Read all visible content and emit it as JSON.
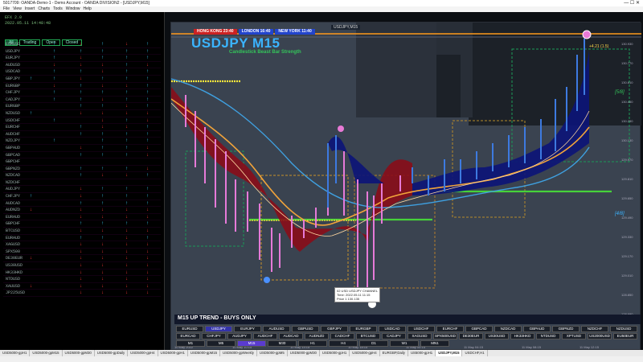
{
  "window": {
    "title": "5017709: OANDA-Demo-1 - Demo Account - OANDA DIVISION2 - [USDJPY,M15]",
    "controls": "— ☐ ✕"
  },
  "menu": [
    "File",
    "View",
    "Insert",
    "Charts",
    "Tools",
    "Window",
    "Help"
  ],
  "left_panel": {
    "header_lines": [
      "EFX 2.0",
      "2022.05.11 14:48:48"
    ],
    "tabs": [
      "All",
      "Trading",
      "Open",
      "Closed"
    ],
    "active_tab": "All",
    "pairs": [
      {
        "name": "EURUSD",
        "cols": [
          "",
          "up",
          "dn",
          "up",
          "dn",
          "up"
        ]
      },
      {
        "name": "USDJPY",
        "cols": [
          "",
          "up",
          "up",
          "up",
          "up",
          "up"
        ]
      },
      {
        "name": "EURJPY",
        "cols": [
          "",
          "up",
          "dn",
          "up",
          "up",
          "up"
        ]
      },
      {
        "name": "AUDUSD",
        "cols": [
          "",
          "dn",
          "dn",
          "dn",
          "up",
          "dn"
        ]
      },
      {
        "name": "USDCAD",
        "cols": [
          "",
          "up",
          "up",
          "dn",
          "up",
          "up"
        ]
      },
      {
        "name": "GBPJPY",
        "cols": [
          "up",
          "up",
          "dn",
          "up",
          "up",
          "up"
        ]
      },
      {
        "name": "EURGBP",
        "cols": [
          "",
          "dn",
          "up",
          "dn",
          "dn",
          "up"
        ]
      },
      {
        "name": "CHFJPY",
        "cols": [
          "",
          "up",
          "up",
          "up",
          "up",
          "up"
        ]
      },
      {
        "name": "CADJPY",
        "cols": [
          "",
          "up",
          "up",
          "dn",
          "up",
          "up"
        ]
      },
      {
        "name": "EURGBP",
        "cols": [
          "",
          "",
          "up",
          "up",
          "dn",
          "up"
        ]
      },
      {
        "name": "NZDUSD",
        "cols": [
          "up",
          "",
          "dn",
          "dn",
          "dn",
          "dn"
        ]
      },
      {
        "name": "USDCHF",
        "cols": [
          "",
          "up",
          "",
          "dn",
          "up",
          "dn"
        ]
      },
      {
        "name": "EURCHF",
        "cols": [
          "",
          "",
          "up",
          "dn",
          "dn",
          "up"
        ]
      },
      {
        "name": "AUDCHF",
        "cols": [
          "",
          "",
          "up",
          "up",
          "up",
          "up"
        ]
      },
      {
        "name": "NZDJPY",
        "cols": [
          "",
          "up",
          "",
          "up",
          "up",
          "up"
        ]
      },
      {
        "name": "GBPAUD",
        "cols": [
          "",
          "",
          "dn",
          "up",
          "up",
          "dn"
        ]
      },
      {
        "name": "GBPCAD",
        "cols": [
          "",
          "",
          "up",
          "up",
          "up",
          "dn"
        ]
      },
      {
        "name": "GBPCHF",
        "cols": [
          "",
          "",
          "",
          "",
          "",
          ""
        ]
      },
      {
        "name": "GBPNZD",
        "cols": [
          "",
          "",
          "up",
          "up",
          "up",
          "dn"
        ]
      },
      {
        "name": "NZDCAD",
        "cols": [
          "",
          "",
          "up",
          "dn",
          "dn",
          "up"
        ]
      },
      {
        "name": "NZDCHF",
        "cols": [
          "",
          "",
          "",
          "",
          "",
          ""
        ]
      },
      {
        "name": "AUDJPY",
        "cols": [
          "",
          "",
          "dn",
          "up",
          "up",
          "up"
        ]
      },
      {
        "name": "CHFJPY",
        "cols": [
          "up",
          "",
          "dn",
          "up",
          "up",
          "up"
        ]
      },
      {
        "name": "AUDCAD",
        "cols": [
          "",
          "",
          "up",
          "up",
          "up",
          "up"
        ]
      },
      {
        "name": "AUDNZD",
        "cols": [
          "dn",
          "",
          "dn",
          "dn",
          "dn",
          "dn"
        ]
      },
      {
        "name": "EURAUD",
        "cols": [
          "",
          "",
          "dn",
          "dn",
          "dn",
          "dn"
        ]
      },
      {
        "name": "GBPCHF",
        "cols": [
          "",
          "",
          "up",
          "up",
          "up",
          "up"
        ]
      },
      {
        "name": "BTCUSD",
        "cols": [
          "",
          "",
          "dn",
          "dn",
          "dn",
          "dn"
        ]
      },
      {
        "name": "EURAUD",
        "cols": [
          "",
          "",
          "up",
          "up",
          "dn",
          "up"
        ]
      },
      {
        "name": "XAGUSD",
        "cols": [
          "",
          "",
          "dn",
          "dn",
          "dn",
          "dn"
        ]
      },
      {
        "name": "SPX500",
        "cols": [
          "",
          "",
          "dn",
          "dn",
          "dn",
          "dn"
        ]
      },
      {
        "name": "DE30EUR",
        "cols": [
          "dn",
          "",
          "dn",
          "dn",
          "dn",
          "dn"
        ]
      },
      {
        "name": "US30USD",
        "cols": [
          "",
          "",
          "dn",
          "dn",
          "dn",
          "dn"
        ]
      },
      {
        "name": "HK33HKD",
        "cols": [
          "",
          "",
          "dn",
          "dn",
          "dn",
          "dn"
        ]
      },
      {
        "name": "NTDUSD",
        "cols": [
          "",
          "",
          "dn",
          "dn",
          "dn",
          "dn"
        ]
      },
      {
        "name": "XAUUSD",
        "cols": [
          "dn",
          "",
          "dn",
          "dn",
          "dn",
          "dn"
        ]
      },
      {
        "name": "JP225USD",
        "cols": [
          "",
          "",
          "dn",
          "dn",
          "dn",
          "dn"
        ]
      }
    ]
  },
  "chart": {
    "window_caption": "USDJPY,M15",
    "symbol_title": "USDJPY M15",
    "subtitle": "Candlestick Beast Bar Strength",
    "sessions": [
      {
        "label": "HONG KONG 23:40",
        "color": "#cc2222"
      },
      {
        "label": "LONDON 16:40",
        "color": "#2244cc"
      },
      {
        "label": "NEW YORK 11:40",
        "color": "#2244cc"
      }
    ],
    "fib_labels": [
      {
        "text": "[5/8]",
        "color": "#34c45a"
      },
      {
        "text": "[4/8]",
        "color": "#3bb4ff"
      }
    ],
    "price_flag": "+4.21 (1.5)",
    "info_box": [
      "02 USD USDJPY CHANNEL",
      "Time: 2022.05.11 11:15",
      "Price 1  130.135"
    ],
    "trend_banner": "M15 UP TREND - BUYS ONLY",
    "price_axis": [
      "130.930",
      "130.770",
      "130.610",
      "130.450",
      "130.290",
      "130.130",
      "129.970",
      "129.810",
      "129.650",
      "129.490",
      "129.330",
      "129.170",
      "129.010",
      "128.850",
      "128.690"
    ],
    "time_axis": [
      "10 May 2022",
      "10 May 10:15",
      "10 May 14:15",
      "10 May 18:15",
      "11 May 00:15",
      "11 May 04:15",
      "11 May 08:15",
      "11 May 12:15"
    ],
    "symbol_rows": [
      [
        "EURUSD",
        "USDJPY",
        "EURJPY",
        "AUDUSD",
        "GBPUSD",
        "GBPJPY",
        "EURGBP",
        "USDCAD",
        "USDCHF",
        "EURCHF",
        "GBPCAD",
        "NZDCAD",
        "GBPAUD",
        "GBPNZD",
        "NZDCHF",
        "NZDUSD"
      ],
      [
        "EURCAD",
        "CHFJPY",
        "AUDJPY",
        "AUDCHF",
        "AUDCAD",
        "AUDNZD",
        "CADCHF",
        "BTCUSD",
        "CADJPY",
        "XAGUSD",
        "SPX500USD",
        "DE30EUR",
        "US30USD",
        "HK33HKD",
        "NTDUSD",
        "XPTUSD",
        "US2000USD",
        "EU50EUR"
      ],
      [
        "M1",
        "M5",
        "M15",
        "M30",
        "H1",
        "H4",
        "D1",
        "W1",
        "MN1"
      ]
    ],
    "selected_symbol": "USDJPY",
    "selected_tf": "M15"
  },
  "bottom_tabs": [
    "USD5000-gpH1",
    "USD5000-gpM15",
    "USD5000-gpM30",
    "USD5000-gpDaily",
    "USD5000-gpH4",
    "USD5000-gpH1",
    "USD5000-gpM15",
    "USD5000-gpWeekly",
    "USD5000-gpM5",
    "USD5000-gpM30",
    "USD5000-gpH1",
    "USD5000-gpH4",
    "EURGBP,Daily",
    "US5000-gpH1",
    "USDJPY,M15",
    "USDCHF,H1"
  ],
  "active_bottom_tab": "USDJPY,M15"
}
